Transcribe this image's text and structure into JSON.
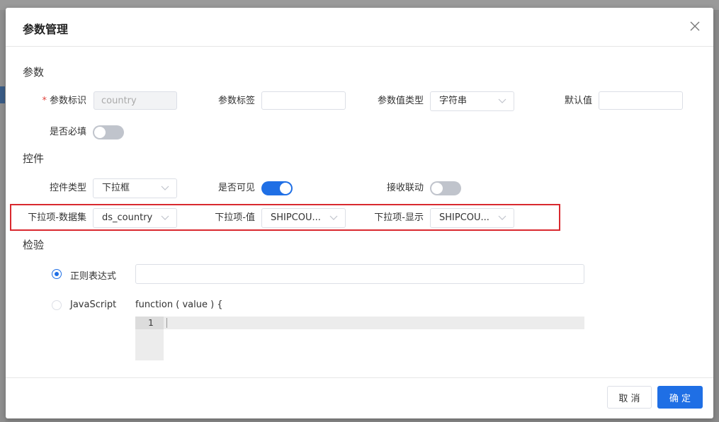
{
  "dialog": {
    "title": "参数管理"
  },
  "sections": {
    "params": "参数",
    "control": "控件",
    "validation": "检验"
  },
  "params": {
    "id_label": "参数标识",
    "id_value": "country",
    "tag_label": "参数标签",
    "tag_value": "",
    "value_type_label": "参数值类型",
    "value_type_selected": "字符串",
    "default_label": "默认值",
    "default_value": "",
    "required_label": "是否必填",
    "required_on": false
  },
  "control": {
    "type_label": "控件类型",
    "type_selected": "下拉框",
    "visible_label": "是否可见",
    "visible_on": true,
    "linkage_label": "接收联动",
    "linkage_on": false,
    "dataset_label": "下拉项-数据集",
    "dataset_selected": "ds_country",
    "value_label": "下拉项-值",
    "value_selected": "SHIPCOU...",
    "display_label": "下拉项-显示",
    "display_selected": "SHIPCOU..."
  },
  "validation": {
    "regex_label": "正则表达式",
    "regex_checked": true,
    "regex_value": "",
    "js_label": "JavaScript",
    "js_checked": false,
    "function_signature": "function ( value ) {",
    "line_number": "1"
  },
  "footer": {
    "cancel_label": "取 消",
    "ok_label": "确 定"
  },
  "colors": {
    "primary": "#1f6fe5",
    "highlight_border": "#d9292f"
  }
}
